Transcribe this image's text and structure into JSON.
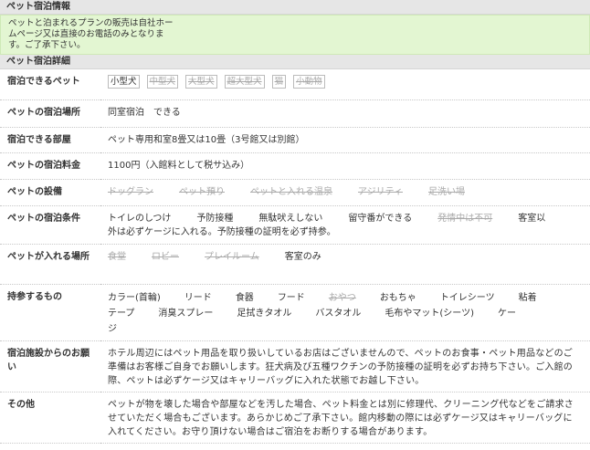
{
  "info": {
    "heading": "ペット宿泊情報",
    "notice_lines": [
      "ペットと泊まれるプランの販売は自社ホー",
      "ムページ又は直接のお電話のみとなりま",
      "す。ご了承下さい。"
    ]
  },
  "detail": {
    "heading": "ペット宿泊詳細",
    "rows": {
      "pets": {
        "label": "宿泊できるペット",
        "items": [
          {
            "text": "小型犬",
            "on": true
          },
          {
            "text": "中型犬",
            "on": false
          },
          {
            "text": "大型犬",
            "on": false
          },
          {
            "text": "超大型犬",
            "on": false
          },
          {
            "text": "猫",
            "on": false
          },
          {
            "text": "小動物",
            "on": false
          }
        ]
      },
      "place": {
        "label": "ペットの宿泊場所",
        "value": "同室宿泊　できる"
      },
      "room": {
        "label": "宿泊できる部屋",
        "value": "ペット専用和室8畳又は10畳（3号館又は別館）"
      },
      "fee": {
        "label": "ペットの宿泊料金",
        "value": "1100円（入館料として税サ込み）"
      },
      "facilities": {
        "label": "ペットの設備",
        "items": [
          {
            "text": "ドッグラン",
            "on": false
          },
          {
            "text": "ペット預り",
            "on": false
          },
          {
            "text": "ペットと入れる温泉",
            "on": false
          },
          {
            "text": "アジリティ",
            "on": false
          },
          {
            "text": "足洗い場",
            "on": false
          }
        ]
      },
      "conditions": {
        "label": "ペットの宿泊条件",
        "items": [
          {
            "text": "トイレのしつけ",
            "on": true
          },
          {
            "text": "予防接種",
            "on": true
          },
          {
            "text": "無駄吠えしない",
            "on": true
          },
          {
            "text": "留守番ができる",
            "on": true
          },
          {
            "text": "発情中は不可",
            "on": false
          },
          {
            "text": "客室以",
            "on": true
          }
        ],
        "note": "外は必ずケージに入れる。予防接種の証明を必ず持参。"
      },
      "areas": {
        "label": "ペットが入れる場所",
        "items": [
          {
            "text": "食堂",
            "on": false
          },
          {
            "text": "ロビー",
            "on": false
          },
          {
            "text": "プレイルーム",
            "on": false
          },
          {
            "text": "客室のみ",
            "on": true
          }
        ]
      },
      "bring": {
        "label": "持参するもの",
        "items": [
          {
            "text": "カラー(首輪)",
            "on": true
          },
          {
            "text": "リード",
            "on": true
          },
          {
            "text": "食器",
            "on": true
          },
          {
            "text": "フード",
            "on": true
          },
          {
            "text": "おやつ",
            "on": false
          },
          {
            "text": "おもちゃ",
            "on": true
          },
          {
            "text": "トイレシーツ",
            "on": true
          },
          {
            "text": "粘着",
            "on": true
          },
          {
            "text": "テープ",
            "on": true
          },
          {
            "text": "消臭スプレー",
            "on": true
          },
          {
            "text": "足拭きタオル",
            "on": true
          },
          {
            "text": "バスタオル",
            "on": true
          },
          {
            "text": "毛布やマット(シーツ)",
            "on": true
          },
          {
            "text": "ケー",
            "on": true
          },
          {
            "text": "ジ",
            "on": true
          }
        ]
      },
      "facility_msg": {
        "label": "宿泊施設からのお願い",
        "value": "ホテル周辺にはペット用品を取り扱いしているお店はございませんので、ペットのお食事・ペット用品などのご準備はお客様ご自身でお願いします。狂犬病及び五種ワクチンの予防接種の証明を必ずお持ち下さい。ご入館の際、ペットは必ずケージ又はキャリーバッグに入れた状態でお越し下さい。"
      },
      "other": {
        "label": "その他",
        "value": "ペットが物を壊した場合や部屋などを汚した場合、ペット料金とは別に修理代、クリーニング代などをご請求させていただく場合もございます。あらかじめご了承下さい。館内移動の際には必ずケージ又はキャリーバッグに入れてください。お守り頂けない場合はご宿泊をお断りする場合があります。"
      }
    }
  }
}
